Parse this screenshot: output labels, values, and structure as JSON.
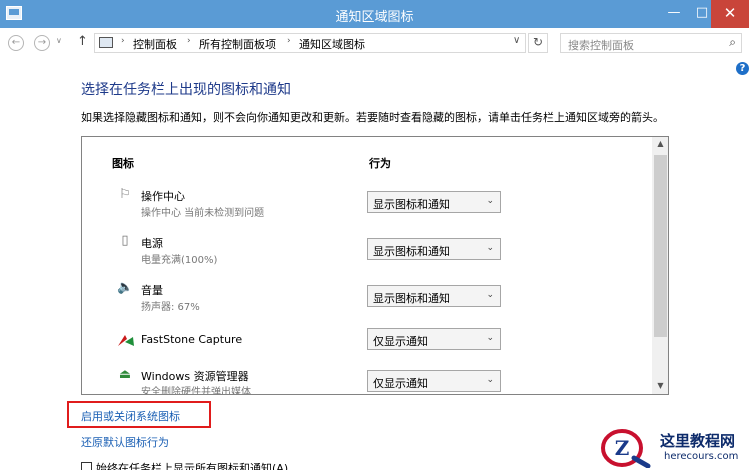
{
  "window": {
    "title": "通知区域图标",
    "min": "—",
    "max": "□",
    "close": "✕"
  },
  "addressbar": {
    "back": "←",
    "forward": "→",
    "history": "∨",
    "up": "↑",
    "crumbs": [
      "控制面板",
      "所有控制面板项",
      "通知区域图标"
    ],
    "sep": "›",
    "dropdown": "∨",
    "refresh": "↻",
    "search_placeholder": "搜索控制面板",
    "search_icon": "⌕"
  },
  "help": "?",
  "heading": "选择在任务栏上出现的图标和通知",
  "description": "如果选择隐藏图标和通知，则不会向你通知更改和更新。若要随时查看隐藏的图标，请单击任务栏上通知区域旁的箭头。",
  "columns": {
    "icons": "图标",
    "action": "行为"
  },
  "rows": [
    {
      "icon": "flag-icon",
      "glyph": "⚐",
      "name": "操作中心",
      "sub": "操作中心  当前未检测到问题",
      "action": "显示图标和通知"
    },
    {
      "icon": "battery-icon",
      "glyph": "▯",
      "name": "电源",
      "sub": "电量充满(100%)",
      "action": "显示图标和通知"
    },
    {
      "icon": "speaker-icon",
      "glyph": "🔈",
      "name": "音量",
      "sub": "扬声器: 67%",
      "action": "显示图标和通知"
    },
    {
      "icon": "faststone-capture-icon",
      "glyph": "",
      "name": "FastStone Capture",
      "sub": "",
      "action": "仅显示通知"
    },
    {
      "icon": "safely-remove-hardware-icon",
      "glyph": "⏏",
      "name": "Windows 资源管理器",
      "sub": "安全删除硬件并弹出媒体",
      "action": "仅显示通知"
    }
  ],
  "select_arrow": "⌄",
  "scroll": {
    "up": "▲",
    "down": "▼"
  },
  "links": {
    "system_icons": "启用或关闭系统图标",
    "restore": "还原默认图标行为"
  },
  "checkbox": {
    "label": "始终在任务栏上显示所有图标和通知(A)",
    "checked": false
  },
  "colors": {
    "titlebar": "#5a9bd5",
    "close": "#c9453a",
    "link": "#1a5fb4",
    "heading": "#1e3a8a",
    "highlight": "#e01c1c"
  },
  "watermark": {
    "title": "这里教程网",
    "url": "herecours.com",
    "letter": "Z"
  }
}
